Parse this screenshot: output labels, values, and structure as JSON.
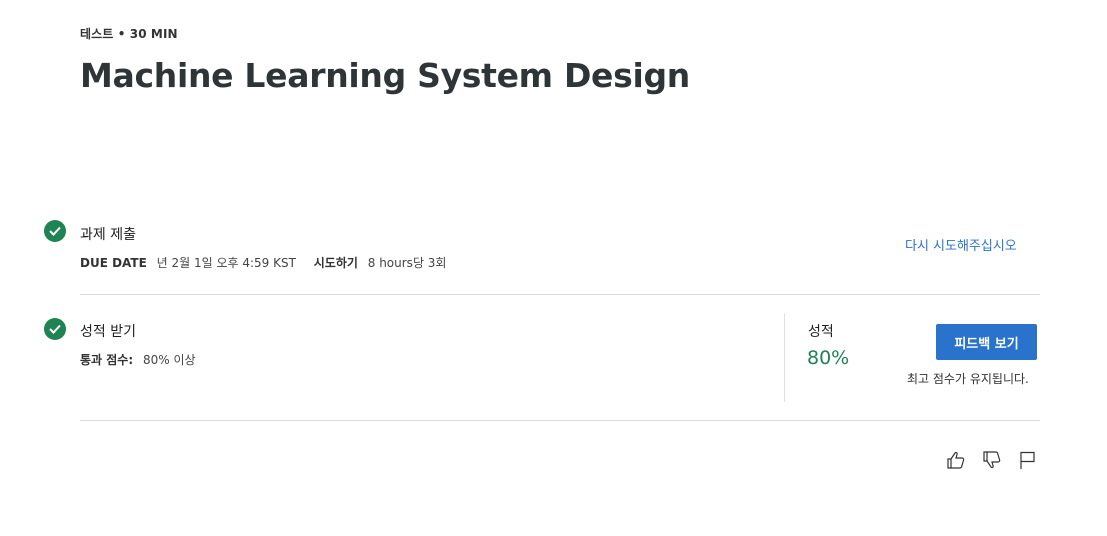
{
  "header": {
    "meta": "테스트 • 30 MIN",
    "title": "Machine Learning System Design"
  },
  "submit_step": {
    "title": "과제 제출",
    "due_label": "DUE DATE",
    "due_value": "년 2월 1일 오후 4:59 KST",
    "attempts_label": "시도하기",
    "attempts_value": "8 hours당 3회",
    "retry_link": "다시 시도해주십시오"
  },
  "grade_step": {
    "title": "성적 받기",
    "pass_label": "통과 점수:",
    "pass_value": "80% 이상",
    "grade_label": "성적",
    "grade_value": "80%",
    "feedback_button": "피드백 보기",
    "keep_note": "최고 점수가 유지됩니다."
  },
  "feedback_icons": [
    "thumbs-up-icon",
    "thumbs-down-icon",
    "flag-icon"
  ],
  "colors": {
    "accent": "#2a73cc",
    "success": "#1f8354",
    "title": "#2f3436"
  }
}
